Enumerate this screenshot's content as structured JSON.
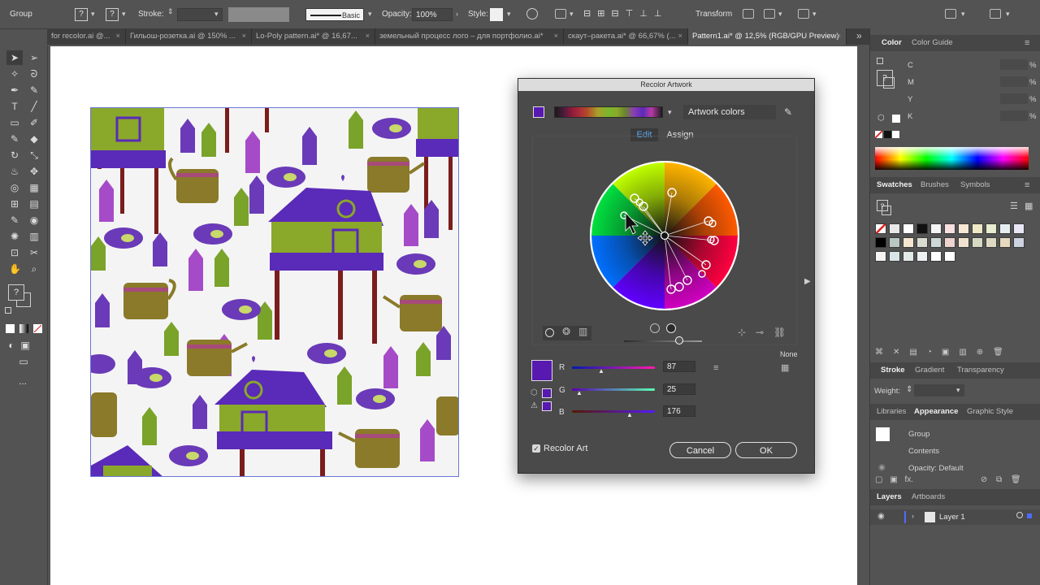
{
  "control_bar": {
    "selection_label": "Group",
    "stroke_label": "Stroke:",
    "brush_label": "Basic",
    "opacity_label": "Opacity:",
    "opacity_value": "100%",
    "style_label": "Style:",
    "transform_label": "Transform",
    "question_mark": "?"
  },
  "tabs": [
    {
      "label": "for recolor.ai @...",
      "active": false
    },
    {
      "label": "Гильош-розетка.ai @ 150% ...",
      "active": false
    },
    {
      "label": "Lo-Poly pattern.ai* @ 16,67...",
      "active": false
    },
    {
      "label": "земельный процесс лого – для портфолио.ai*",
      "active": false
    },
    {
      "label": "скаут–ракета.ai* @ 66,67% (...",
      "active": false
    },
    {
      "label": "Pattern1.ai* @ 12,5% (RGB/GPU Preview)",
      "active": true
    }
  ],
  "tools_panel": {
    "fill_unknown": "?",
    "more": "..."
  },
  "dialog": {
    "title": "Recolor Artwork",
    "preset": "Artwork colors",
    "tab_edit": "Edit",
    "tab_assign": "Assign",
    "r_label": "R",
    "g_label": "G",
    "b_label": "B",
    "r_value": "87",
    "g_value": "25",
    "b_value": "176",
    "none_label": "None",
    "recolor_art_label": "Recolor Art",
    "recolor_art_checked": true,
    "cancel_label": "Cancel",
    "ok_label": "OK",
    "current_color": "#5719b0"
  },
  "color_panel": {
    "tab_color": "Color",
    "tab_color_guide": "Color Guide",
    "c_label": "C",
    "m_label": "M",
    "y_label": "Y",
    "k_label": "K"
  },
  "swatches_panel": {
    "tab_swatches": "Swatches",
    "tab_brushes": "Brushes",
    "tab_symbols": "Symbols"
  },
  "stroke_panel": {
    "tab_stroke": "Stroke",
    "tab_gradient": "Gradient",
    "tab_transparency": "Transparency",
    "weight_label": "Weight:"
  },
  "appearance_panel": {
    "tab_libraries": "Libraries",
    "tab_appearance": "Appearance",
    "tab_graphic_style": "Graphic Style",
    "item_group": "Group",
    "item_contents": "Contents",
    "item_opacity": "Opacity: Default",
    "fx_label": "fx."
  },
  "layers_panel": {
    "tab_layers": "Layers",
    "tab_artboards": "Artboards",
    "layer_name": "Layer 1"
  }
}
